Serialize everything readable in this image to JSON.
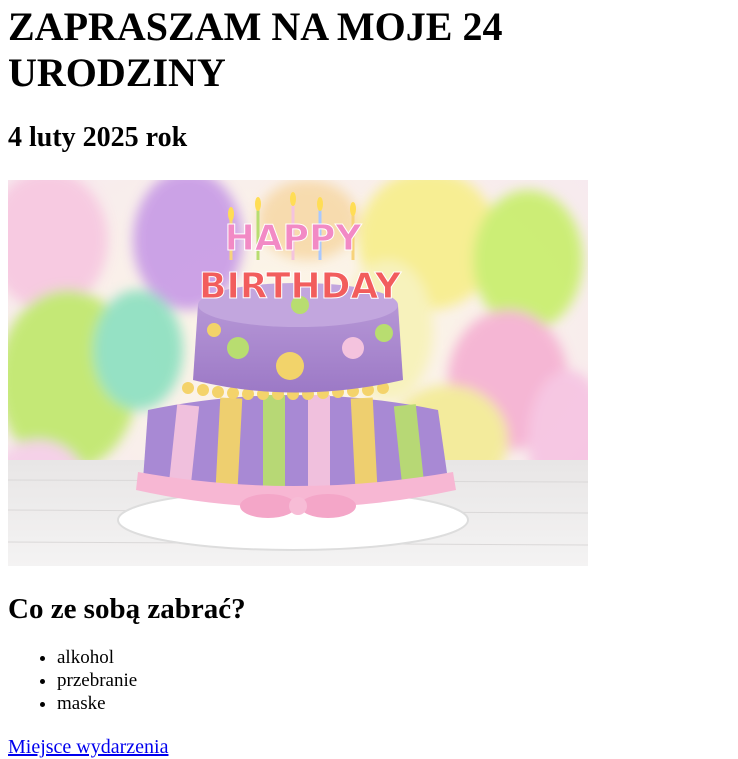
{
  "page": {
    "title": "ZAPRASZAM NA MOJE 24 URODZINY",
    "date": "4 luty 2025 rok"
  },
  "image": {
    "icon": "birthday-cake-photo",
    "letters_top": "HAPPY",
    "letters_bottom": "BIRTHDAY"
  },
  "bring": {
    "heading": "Co ze sobą zabrać?",
    "items": [
      "alkohol",
      "przebranie",
      "maske"
    ]
  },
  "link": {
    "label": "Miejsce wydarzenia"
  }
}
